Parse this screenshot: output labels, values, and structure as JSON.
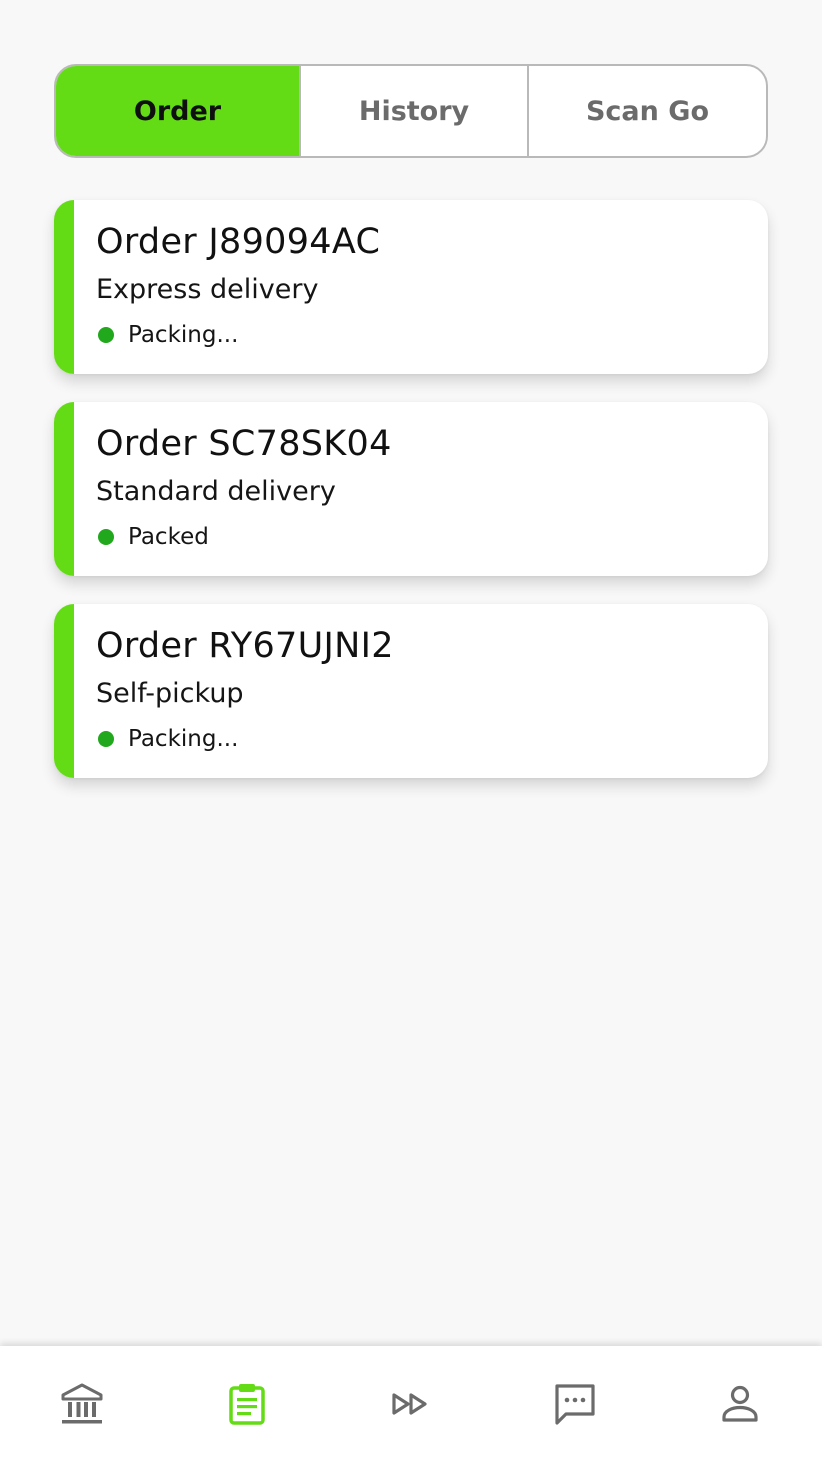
{
  "tabs": [
    {
      "label": "Order",
      "active": true
    },
    {
      "label": "History",
      "active": false
    },
    {
      "label": "Scan Go",
      "active": false
    }
  ],
  "orders": [
    {
      "title": "Order J89094AC",
      "delivery": "Express delivery",
      "status": "Packing..."
    },
    {
      "title": "Order SC78SK04",
      "delivery": "Standard delivery",
      "status": "Packed"
    },
    {
      "title": "Order RY67UJNI2",
      "delivery": "Self-pickup",
      "status": "Packing..."
    }
  ],
  "colors": {
    "accent": "#63dc16",
    "status_dot": "#22a81c",
    "icon_inactive": "#6b6b6b"
  },
  "bottom_nav": [
    {
      "icon": "bank-icon",
      "active": false
    },
    {
      "icon": "clipboard-icon",
      "active": true
    },
    {
      "icon": "fast-forward-icon",
      "active": false
    },
    {
      "icon": "chat-icon",
      "active": false
    },
    {
      "icon": "person-icon",
      "active": false
    }
  ]
}
